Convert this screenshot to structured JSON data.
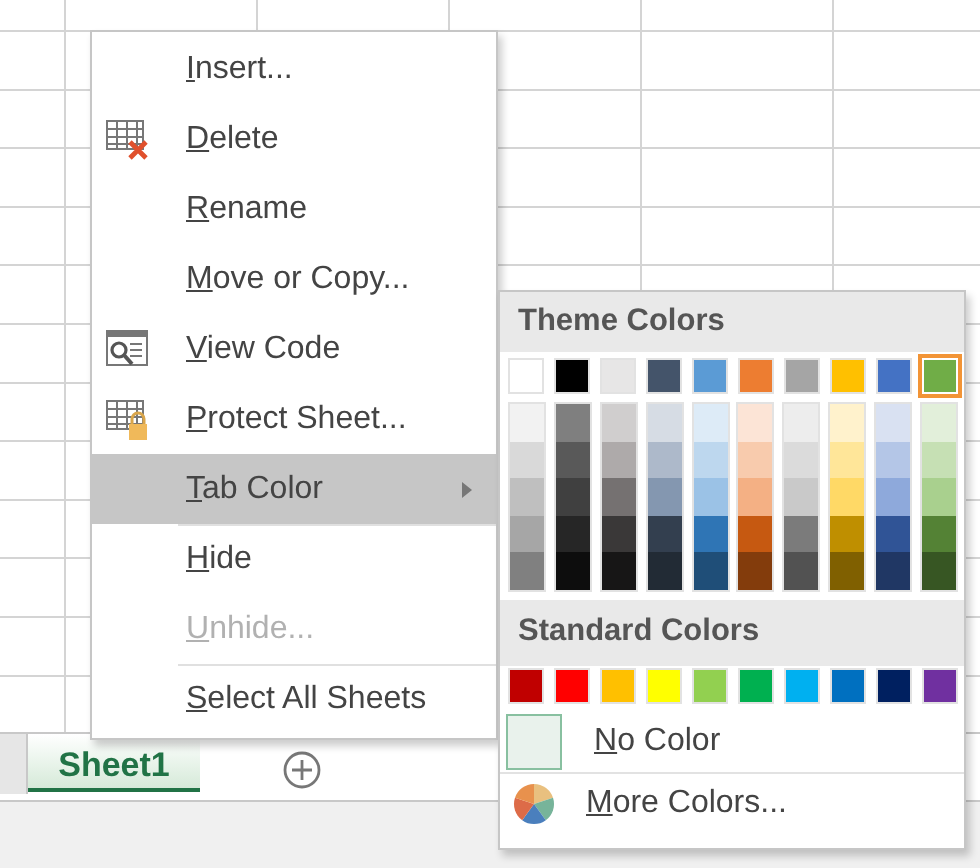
{
  "sheet_tabs": [
    {
      "label": "Sheet1",
      "selected": true
    }
  ],
  "context_menu": {
    "items": [
      {
        "label": "Insert...",
        "kind": "plain",
        "disabled": false,
        "selected": false,
        "submenu": false,
        "separator_before": false
      },
      {
        "label": "Delete",
        "kind": "delete",
        "disabled": false,
        "selected": false,
        "submenu": false,
        "separator_before": false
      },
      {
        "label": "Rename",
        "kind": "plain",
        "disabled": false,
        "selected": false,
        "submenu": false,
        "separator_before": false
      },
      {
        "label": "Move or Copy...",
        "kind": "plain",
        "disabled": false,
        "selected": false,
        "submenu": false,
        "separator_before": false
      },
      {
        "label": "View Code",
        "kind": "code",
        "disabled": false,
        "selected": false,
        "submenu": false,
        "separator_before": false
      },
      {
        "label": "Protect Sheet...",
        "kind": "protect",
        "disabled": false,
        "selected": false,
        "submenu": false,
        "separator_before": false
      },
      {
        "label": "Tab Color",
        "kind": "plain",
        "disabled": false,
        "selected": true,
        "submenu": true,
        "separator_before": false
      },
      {
        "label": "Hide",
        "kind": "plain",
        "disabled": false,
        "selected": false,
        "submenu": false,
        "separator_before": true
      },
      {
        "label": "Unhide...",
        "kind": "plain",
        "disabled": true,
        "selected": false,
        "submenu": false,
        "separator_before": false
      },
      {
        "label": "Select All Sheets",
        "kind": "plain",
        "disabled": false,
        "selected": false,
        "submenu": false,
        "separator_before": true
      }
    ]
  },
  "color_menu": {
    "theme_title": "Theme Colors",
    "theme_colors": [
      {
        "color": "#ffffff",
        "selected": false,
        "shades": [
          {
            "color": "#f2f2f2"
          },
          {
            "color": "#d9d9d9"
          },
          {
            "color": "#bfbfbf"
          },
          {
            "color": "#a6a6a6"
          },
          {
            "color": "#808080"
          }
        ]
      },
      {
        "color": "#000000",
        "selected": false,
        "shades": [
          {
            "color": "#7f7f7f"
          },
          {
            "color": "#595959"
          },
          {
            "color": "#404040"
          },
          {
            "color": "#262626"
          },
          {
            "color": "#0d0d0d"
          }
        ]
      },
      {
        "color": "#e7e6e6",
        "selected": false,
        "shades": [
          {
            "color": "#d0cece"
          },
          {
            "color": "#aeaaaa"
          },
          {
            "color": "#757171"
          },
          {
            "color": "#3a3838"
          },
          {
            "color": "#171616"
          }
        ]
      },
      {
        "color": "#44546a",
        "selected": false,
        "shades": [
          {
            "color": "#d6dce4"
          },
          {
            "color": "#adb9ca"
          },
          {
            "color": "#8497b0"
          },
          {
            "color": "#333f4f"
          },
          {
            "color": "#222b35"
          }
        ]
      },
      {
        "color": "#5b9bd5",
        "selected": false,
        "shades": [
          {
            "color": "#ddebf7"
          },
          {
            "color": "#bdd7ee"
          },
          {
            "color": "#9bc2e6"
          },
          {
            "color": "#2f75b5"
          },
          {
            "color": "#1f4e78"
          }
        ]
      },
      {
        "color": "#ed7d31",
        "selected": false,
        "shades": [
          {
            "color": "#fce4d6"
          },
          {
            "color": "#f8cbad"
          },
          {
            "color": "#f4b084"
          },
          {
            "color": "#c65911"
          },
          {
            "color": "#833c0c"
          }
        ]
      },
      {
        "color": "#a5a5a5",
        "selected": false,
        "shades": [
          {
            "color": "#ededed"
          },
          {
            "color": "#dbdbdb"
          },
          {
            "color": "#c9c9c9"
          },
          {
            "color": "#7b7b7b"
          },
          {
            "color": "#525252"
          }
        ]
      },
      {
        "color": "#ffc000",
        "selected": false,
        "shades": [
          {
            "color": "#fff2cc"
          },
          {
            "color": "#ffe699"
          },
          {
            "color": "#ffd966"
          },
          {
            "color": "#bf8f00"
          },
          {
            "color": "#806000"
          }
        ]
      },
      {
        "color": "#4472c4",
        "selected": false,
        "shades": [
          {
            "color": "#d9e1f2"
          },
          {
            "color": "#b4c6e7"
          },
          {
            "color": "#8ea9db"
          },
          {
            "color": "#305496"
          },
          {
            "color": "#203764"
          }
        ]
      },
      {
        "color": "#70ad47",
        "selected": true,
        "shades": [
          {
            "color": "#e2efda"
          },
          {
            "color": "#c6e0b4"
          },
          {
            "color": "#a9d08e"
          },
          {
            "color": "#548235"
          },
          {
            "color": "#375623"
          }
        ]
      }
    ],
    "standard_title": "Standard Colors",
    "standard_colors": [
      {
        "color": "#c00000",
        "selected": false
      },
      {
        "color": "#ff0000",
        "selected": false
      },
      {
        "color": "#ffc000",
        "selected": false
      },
      {
        "color": "#ffff00",
        "selected": false
      },
      {
        "color": "#92d050",
        "selected": false
      },
      {
        "color": "#00b050",
        "selected": false
      },
      {
        "color": "#00b0f0",
        "selected": false
      },
      {
        "color": "#0070c0",
        "selected": false
      },
      {
        "color": "#002060",
        "selected": false
      },
      {
        "color": "#7030a0",
        "selected": false
      }
    ],
    "no_color": {
      "label": "No Color"
    },
    "more_colors": {
      "label": "More Colors..."
    }
  }
}
